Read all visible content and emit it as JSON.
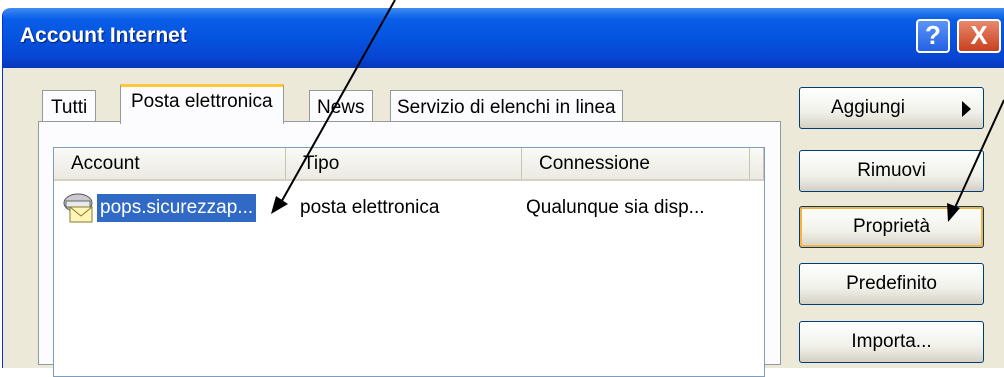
{
  "window": {
    "title": "Account Internet",
    "help_glyph": "?",
    "close_glyph": "X"
  },
  "tabs": [
    {
      "label": "Tutti",
      "selected": false
    },
    {
      "label": "Posta elettronica",
      "selected": true
    },
    {
      "label": "News",
      "selected": false
    },
    {
      "label": "Servizio di elenchi in linea",
      "selected": false
    }
  ],
  "list": {
    "columns": [
      "Account",
      "Tipo",
      "Connessione"
    ],
    "rows": [
      {
        "icon": "mail-account-icon",
        "account": "pops.sicurezzap...",
        "tipo": "posta elettronica",
        "connessione": "Qualunque sia disp...",
        "selected": true
      }
    ]
  },
  "buttons": {
    "add": {
      "label": "Aggiungi",
      "icon": "triangle-right-icon"
    },
    "remove": "Rimuovi",
    "properties": "Proprietà",
    "default": "Predefinito",
    "import": "Importa..."
  },
  "colors": {
    "titlebar": "#0553e0",
    "selection": "#316ac5",
    "focus_ring": "#f8b33a",
    "window_face": "#ece9d8"
  }
}
